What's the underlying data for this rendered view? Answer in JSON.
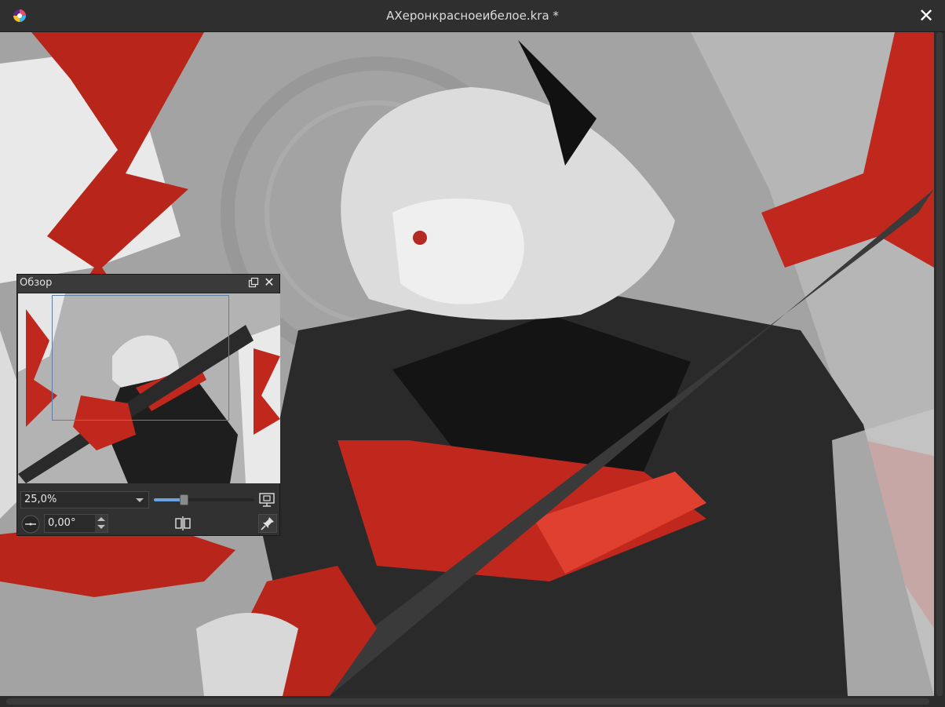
{
  "window": {
    "title": "АХеронкрасноеибелое.kra *",
    "close_glyph": "✕"
  },
  "overview": {
    "title": "Обзор",
    "close_glyph": "✕",
    "zoom_value": "25,0%",
    "zoom_level_fraction": 0.28,
    "rotation_value": "0,00°"
  },
  "icons": {
    "app": "krita-logo-icon",
    "float": "float-docker-icon",
    "fit": "fit-to-view-icon",
    "rotate": "rotate-icon",
    "mirror": "mirror-icon",
    "pin": "pin-icon"
  },
  "colors": {
    "accent_red": "#c0281e",
    "slider_fill": "#6aa3e0",
    "viewport_outline": "#5d7fa8"
  }
}
